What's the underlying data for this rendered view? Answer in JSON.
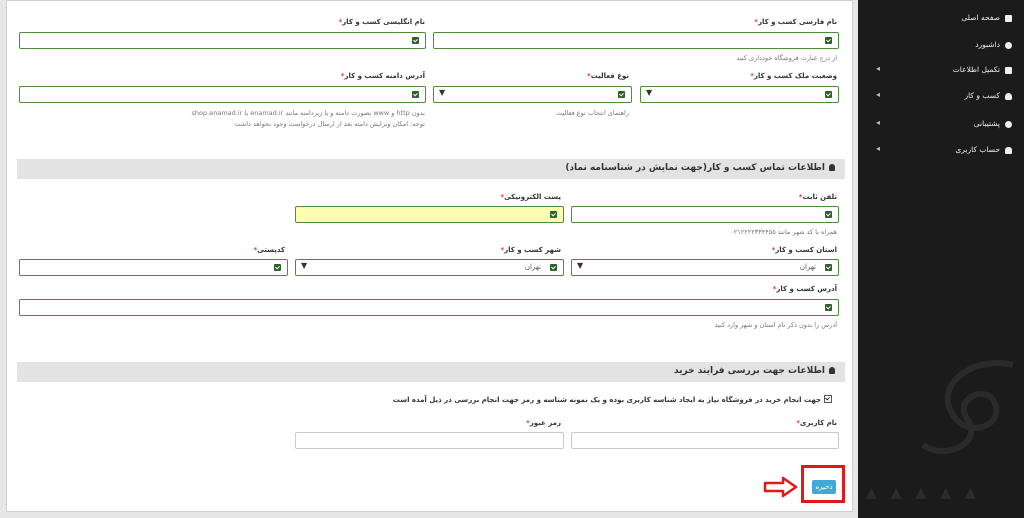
{
  "business": {
    "persian_name_label": "نام فارسی کسب و کار",
    "persian_name_help": "از درج عبارت فروشگاه خودداری کنید",
    "english_name_label": "نام انگلیسی کسب و کار",
    "ownership_label": "وضعیت ملک کسب و کار",
    "activity_label": "نوع فعالیت",
    "activity_help": "راهنمای انتخاب نوع فعالیت",
    "domain_label": "آدرس دامنه کسب و کار",
    "domain_help_1": "بدون http و www بصورت دامنه و یا زیردامنه مانند enamad.ir یا shop.enamad.ir",
    "domain_help_2": "توجه: امکان ویرایش دامنه بعد از ارسال درخواست وجود نخواهد داشت"
  },
  "contact_section": {
    "title": "اطلاعات تماس کسب و کار(جهت نمایش در شناسنامه نماد)",
    "phone_label": "تلفن ثابت",
    "phone_help": "همراه با کد شهر مانند ۰۲۱۲۲۲۲۳۳۴۴۵۵",
    "email_label": "پست الکترونیکی",
    "province_label": "استان کسب و کار",
    "province_value": "تهران",
    "city_label": "شهر کسب و کار",
    "city_value": "تهران",
    "postal_label": "کدپستی",
    "address_label": "آدرس کسب و کار",
    "address_help": "آدرس را بدون ذکر نام استان و شهر وارد کنید"
  },
  "purchase_section": {
    "title": "اطلاعات جهت بررسی فرایند خرید",
    "checkbox_text": "جهت انجام خرید در فروشگاه نیاز به ایجاد شناسه کاربری بوده و یک نمونه شناسه و رمز جهت انجام بررسی در ذیل آمده است",
    "username_label": "نام کاربری",
    "password_label": "رمز عبور"
  },
  "actions": {
    "save_label": "ذخیره"
  },
  "sidebar": {
    "items": [
      {
        "label": "صفحه اصلی",
        "icon": "home-icon"
      },
      {
        "label": "داشبورد",
        "icon": "dashboard-icon"
      },
      {
        "label": "تکمیل اطلاعات",
        "icon": "form-icon"
      },
      {
        "label": "کسب و کار",
        "icon": "cloud-icon"
      },
      {
        "label": "پشتیبانی",
        "icon": "support-icon"
      },
      {
        "label": "حساب کاربری",
        "icon": "user-icon"
      }
    ]
  },
  "colors": {
    "accent": "#3fa9d8",
    "highlight": "#e0191b",
    "valid_border": "#4c8d3a",
    "sidebar_bg": "#1b1b1b"
  }
}
